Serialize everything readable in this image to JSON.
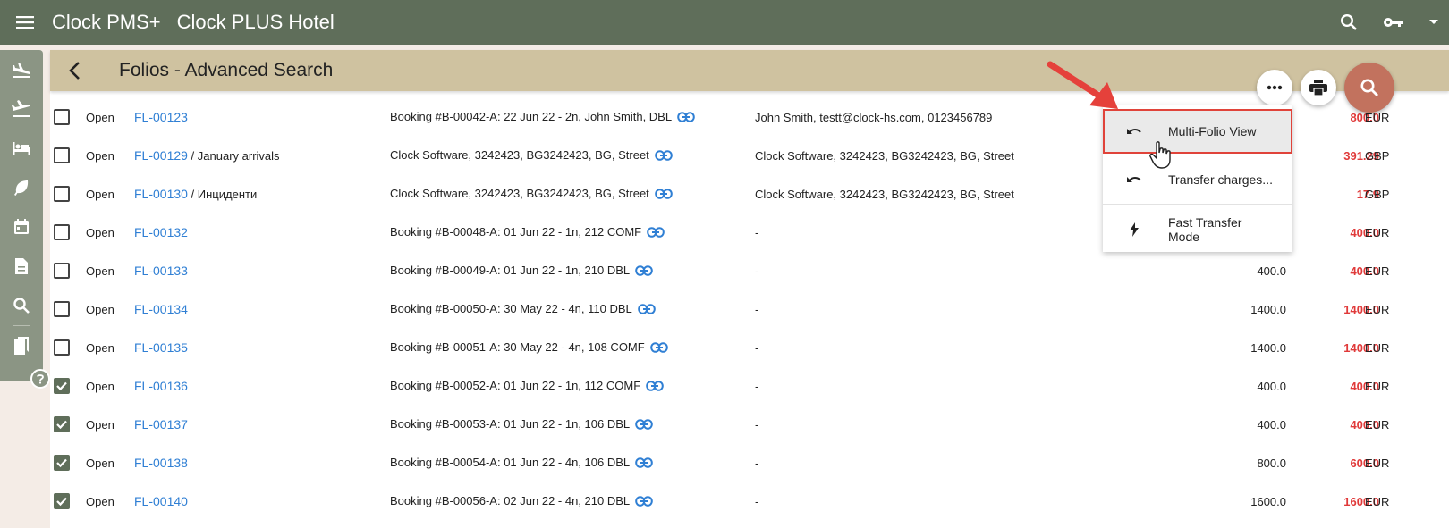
{
  "app": {
    "name": "Clock PMS+",
    "hotel": "Clock PLUS Hotel"
  },
  "page": {
    "title": "Folios - Advanced Search"
  },
  "menu": {
    "items": [
      {
        "label": "Multi-Folio View",
        "icon": "undo-icon"
      },
      {
        "label": "Transfer charges...",
        "icon": "undo-icon"
      },
      {
        "label": "Fast Transfer Mode",
        "icon": "lightning-icon"
      }
    ]
  },
  "rows": [
    {
      "checked": false,
      "status": "Open",
      "folio": "FL-00123",
      "extra": "",
      "booking": "Booking #B-00042-A: 22 Jun 22 - 2n, John Smith, DBL",
      "guest": "John Smith, testt@clock-hs.com, 0123456789",
      "amount": "",
      "balance": "800.0",
      "currency": "EUR"
    },
    {
      "checked": false,
      "status": "Open",
      "folio": "FL-00129",
      "extra": " / January arrivals",
      "booking": "Clock Software, 3242423, BG3242423, BG, Street",
      "guest": "Clock Software, 3242423, BG3242423, BG, Street",
      "amount": "",
      "balance": "391.29",
      "currency": "GBP"
    },
    {
      "checked": false,
      "status": "Open",
      "folio": "FL-00130",
      "extra": " / Инциденти",
      "booking": "Clock Software, 3242423, BG3242423, BG, Street",
      "guest": "Clock Software, 3242423, BG3242423, BG, Street",
      "amount": "",
      "balance": "17.9",
      "currency": "GBP"
    },
    {
      "checked": false,
      "status": "Open",
      "folio": "FL-00132",
      "extra": "",
      "booking": "Booking #B-00048-A: 01 Jun 22 - 1n, 212 COMF",
      "guest": "-",
      "amount": "",
      "balance": "400.0",
      "currency": "EUR"
    },
    {
      "checked": false,
      "status": "Open",
      "folio": "FL-00133",
      "extra": "",
      "booking": "Booking #B-00049-A: 01 Jun 22 - 1n, 210 DBL",
      "guest": "-",
      "amount": "400.0",
      "balance": "400.0",
      "currency": "EUR"
    },
    {
      "checked": false,
      "status": "Open",
      "folio": "FL-00134",
      "extra": "",
      "booking": "Booking #B-00050-A: 30 May 22 - 4n, 110 DBL",
      "guest": "-",
      "amount": "1400.0",
      "balance": "1400.0",
      "currency": "EUR"
    },
    {
      "checked": false,
      "status": "Open",
      "folio": "FL-00135",
      "extra": "",
      "booking": "Booking #B-00051-A: 30 May 22 - 4n, 108 COMF",
      "guest": "-",
      "amount": "1400.0",
      "balance": "1400.0",
      "currency": "EUR"
    },
    {
      "checked": true,
      "status": "Open",
      "folio": "FL-00136",
      "extra": "",
      "booking": "Booking #B-00052-A: 01 Jun 22 - 1n, 112 COMF",
      "guest": "-",
      "amount": "400.0",
      "balance": "400.0",
      "currency": "EUR"
    },
    {
      "checked": true,
      "status": "Open",
      "folio": "FL-00137",
      "extra": "",
      "booking": "Booking #B-00053-A: 01 Jun 22 - 1n, 106 DBL",
      "guest": "-",
      "amount": "400.0",
      "balance": "400.0",
      "currency": "EUR"
    },
    {
      "checked": true,
      "status": "Open",
      "folio": "FL-00138",
      "extra": "",
      "booking": "Booking #B-00054-A: 01 Jun 22 - 4n, 106 DBL",
      "guest": "-",
      "amount": "800.0",
      "balance": "600.0",
      "currency": "EUR"
    },
    {
      "checked": true,
      "status": "Open",
      "folio": "FL-00140",
      "extra": "",
      "booking": "Booking #B-00056-A: 02 Jun 22 - 4n, 210 DBL",
      "guest": "-",
      "amount": "1600.0",
      "balance": "1600.0",
      "currency": "EUR"
    }
  ],
  "colors": {
    "topbar": "#5f6e5a",
    "subheader": "#cfc2a0",
    "link": "#2f7fd4",
    "balance": "#e03a3a",
    "search_fab": "#c2725e"
  }
}
